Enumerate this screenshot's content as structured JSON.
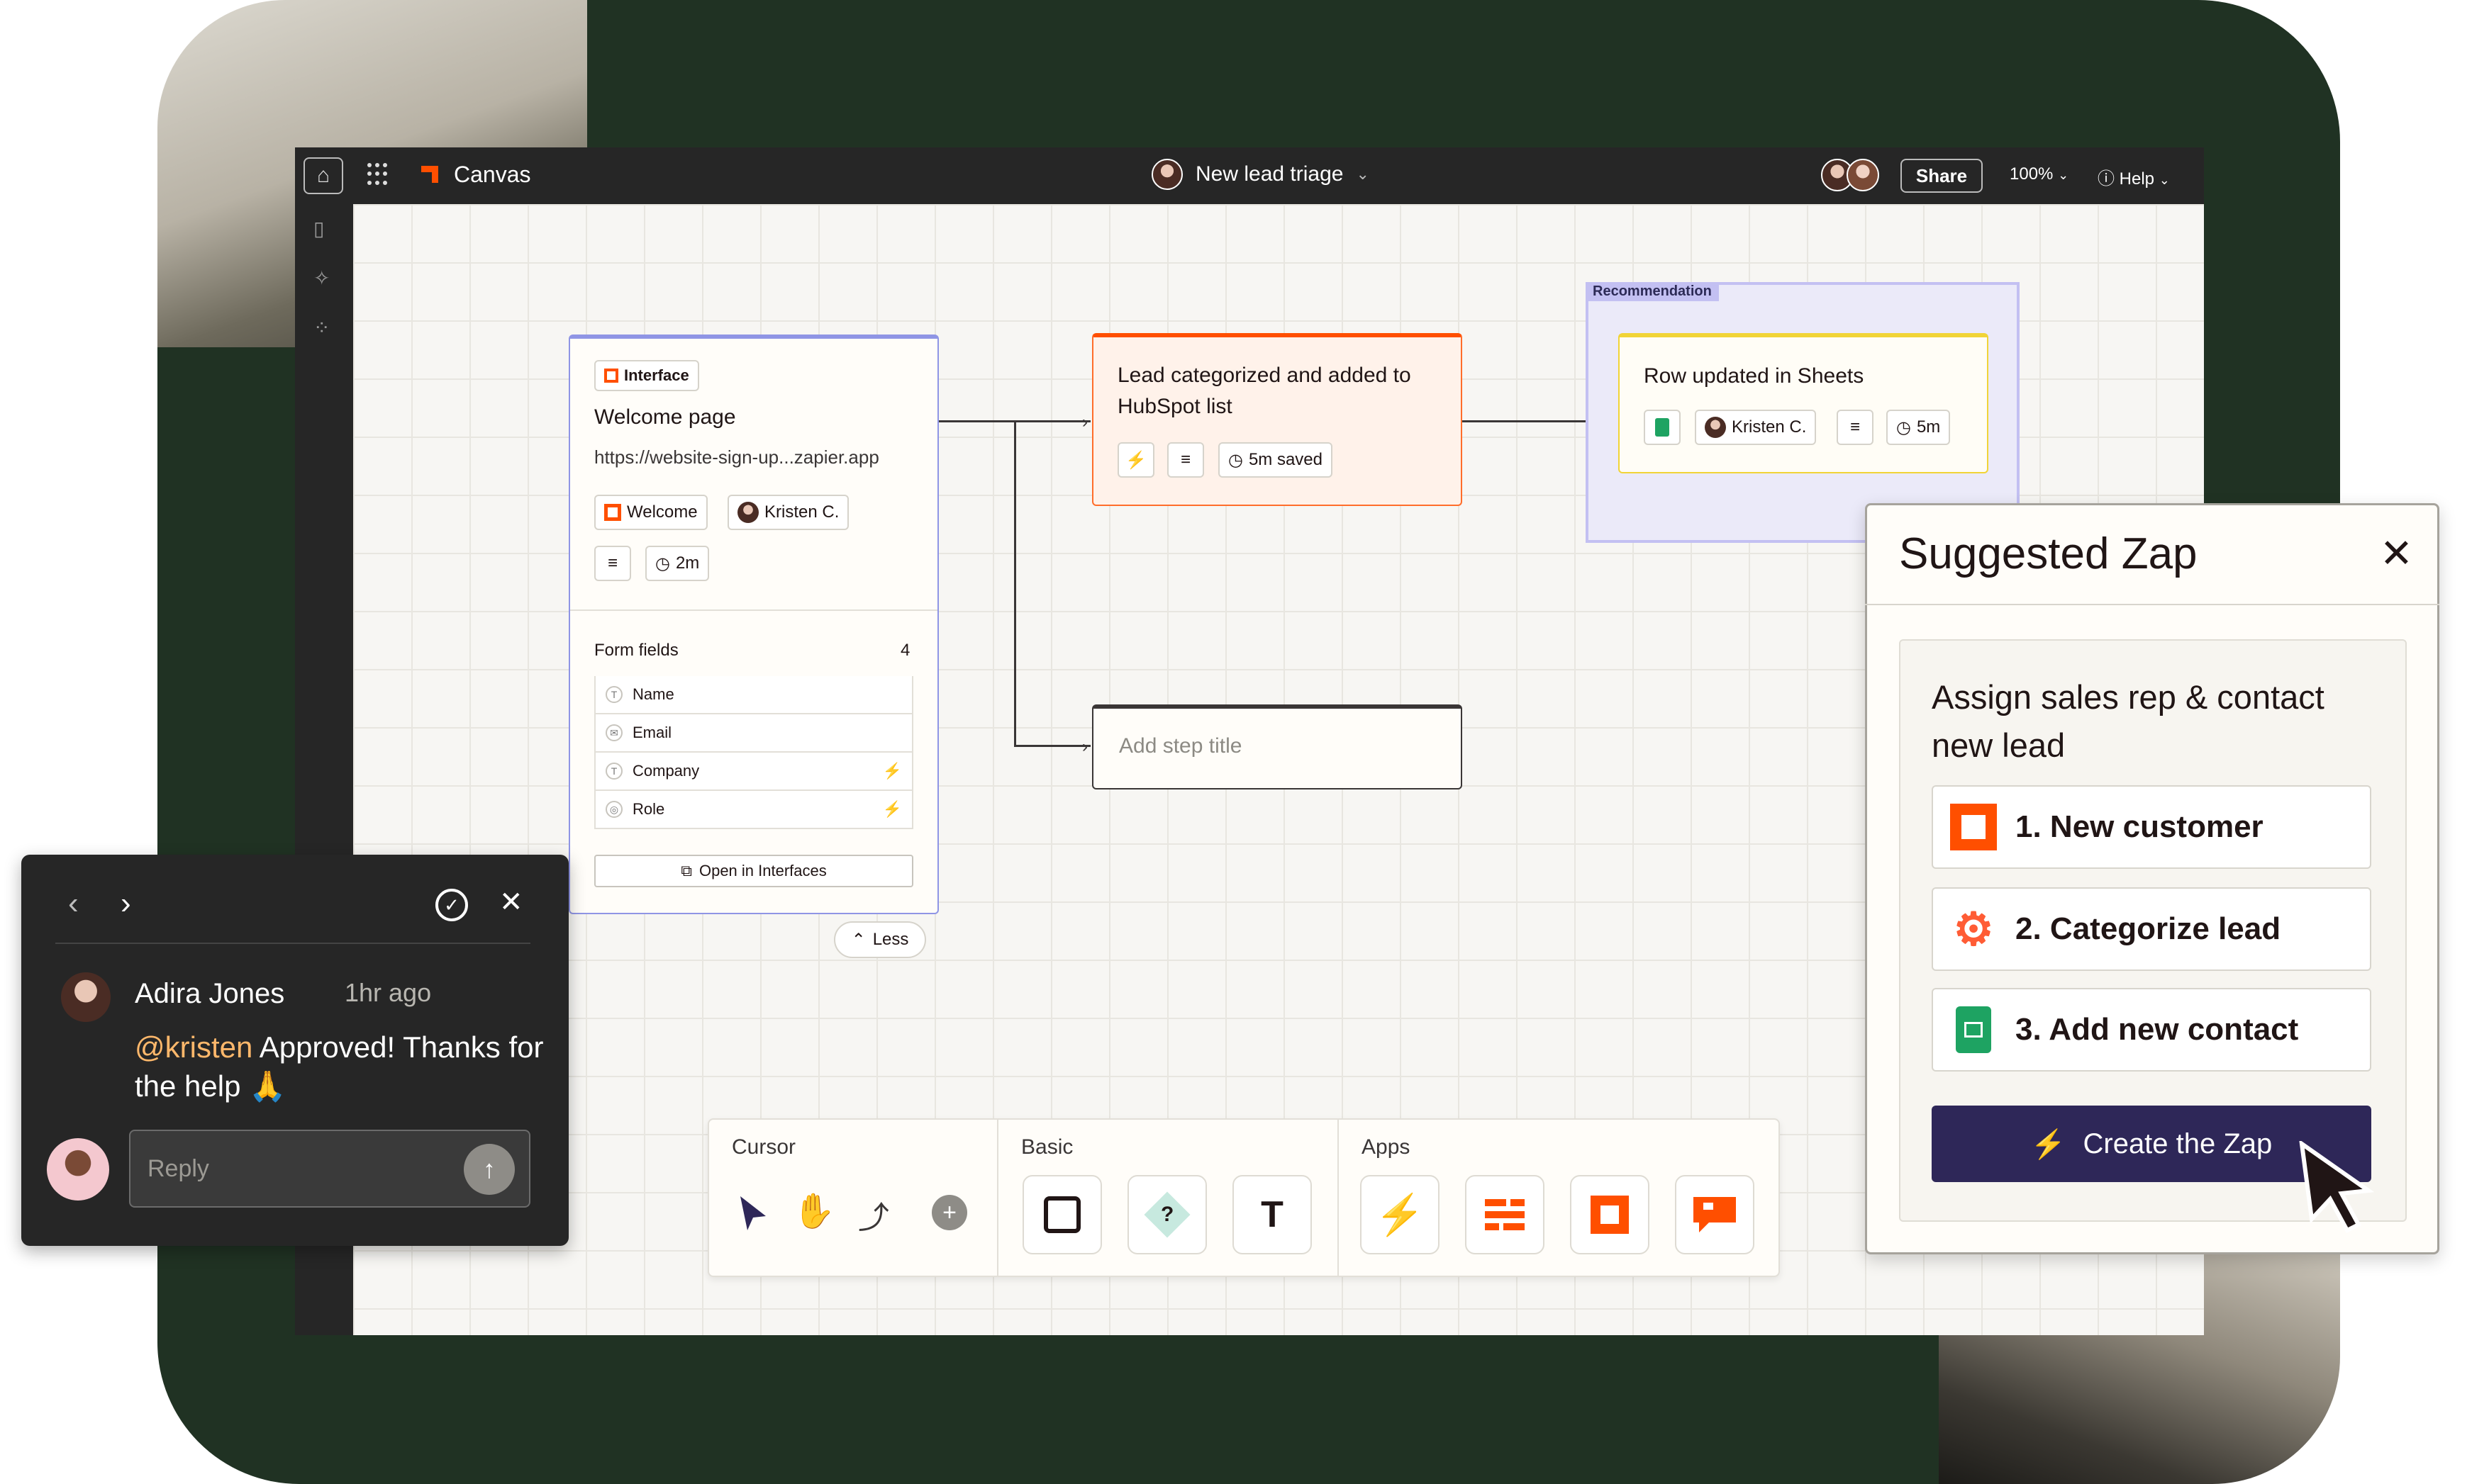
{
  "app": {
    "title": "Canvas",
    "zap_name": "New lead triage",
    "share_label": "Share",
    "zoom": "100%",
    "help_label": "Help"
  },
  "interface_card": {
    "badge": "Interface",
    "title": "Welcome page",
    "url": "https://website-sign-up...zapier.app",
    "page_pill": "Welcome",
    "owner": "Kristen C.",
    "time": "2m",
    "fields_label": "Form fields",
    "fields_count": "4",
    "fields": [
      {
        "type": "T",
        "name": "Name",
        "bolt": false
      },
      {
        "type": "✉",
        "name": "Email",
        "bolt": false
      },
      {
        "type": "T",
        "name": "Company",
        "bolt": true
      },
      {
        "type": "◎",
        "name": "Role",
        "bolt": true
      }
    ],
    "open_label": "Open in Interfaces"
  },
  "lead_card": {
    "title": "Lead categorized and added to HubSpot list",
    "saved": "5m saved"
  },
  "sheets_card": {
    "title": "Row updated in Sheets",
    "owner": "Kristen C.",
    "time": "5m"
  },
  "recommendation_label": "Recommendation",
  "add_step": {
    "placeholder": "Add step title"
  },
  "less_label": "Less",
  "toolbar": {
    "cursor_label": "Cursor",
    "basic_label": "Basic",
    "apps_label": "Apps"
  },
  "suggested": {
    "title": "Suggested Zap",
    "description": "Assign sales rep & contact new lead",
    "steps": [
      "1. New customer",
      "2. Categorize lead",
      "3. Add new contact"
    ],
    "create_label": "Create the Zap"
  },
  "comment": {
    "author": "Adira Jones",
    "time": "1hr ago",
    "mention": "@kristen",
    "text": " Approved! Thanks for the help 🙏",
    "reply_placeholder": "Reply"
  },
  "colors": {
    "brand_orange": "#ff4f00",
    "dark_green": "#203223",
    "create_button": "#2e2758"
  }
}
